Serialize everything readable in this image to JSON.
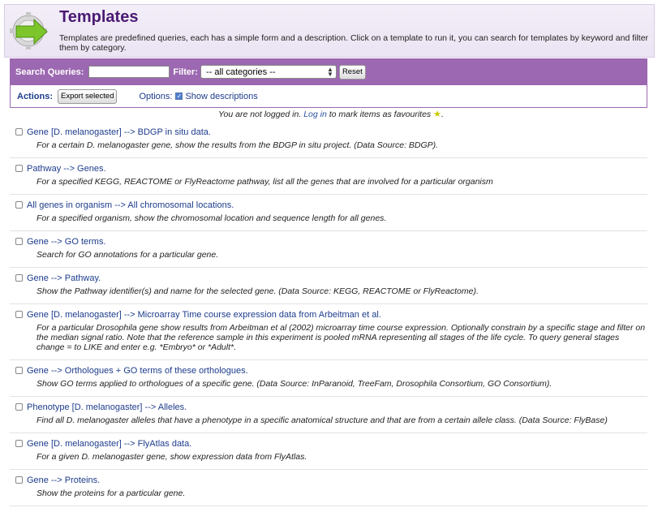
{
  "header": {
    "icon": "templates-gear-arrow-icon",
    "title": "Templates",
    "intro": "Templates are predefined queries, each has a simple form and a description. Click on a template to run it, you can search for templates by keyword and filter them by category."
  },
  "search": {
    "label": "Search Queries:",
    "value": "",
    "filter_label": "Filter:",
    "filter_value": "-- all categories --",
    "reset_label": "Reset"
  },
  "actions": {
    "label": "Actions:",
    "export_label": "Export selected",
    "options_label": "Options:",
    "show_descriptions_label": "Show descriptions",
    "show_descriptions_checked": true
  },
  "login_note": {
    "prefix": "You are not logged in.",
    "link": "Log in",
    "suffix": "to mark items as favourites",
    "star_icon": "star-icon"
  },
  "templates": [
    {
      "title": "Gene [D. melanogaster] --> BDGP in situ data.",
      "description": "For a certain D. melanogaster gene, show the results from the BDGP in situ project. (Data Source: BDGP)."
    },
    {
      "title": "Pathway --> Genes.",
      "description": "For a specified KEGG, REACTOME or FlyReactome pathway, list all the genes that are involved for a particular organism"
    },
    {
      "title": "All genes in organism --> All chromosomal locations.",
      "description": "For a specified organism, show the chromosomal location and sequence length for all genes."
    },
    {
      "title": "Gene --> GO terms.",
      "description": "Search for GO annotations for a particular gene."
    },
    {
      "title": "Gene --> Pathway.",
      "description": "Show the Pathway identifier(s) and name for the selected gene. (Data Source: KEGG, REACTOME or FlyReactome)."
    },
    {
      "title": "Gene [D. melanogaster] --> Microarray Time course expression data from Arbeitman et al.",
      "description": "For a particular Drosophila gene show results from Arbeitman et al (2002) microarray time course expression. Optionally constrain by a specific stage and filter on the median signal ratio. Note that the reference sample in this experiment is pooled mRNA representing all stages of the life cycle. To query general stages change = to LIKE and enter e.g. *Embryo* or *Adult*."
    },
    {
      "title": "Gene --> Orthologues + GO terms of these orthologues.",
      "description": "Show GO terms applied to orthologues of a specific gene. (Data Source: InParanoid, TreeFam, Drosophila Consortium, GO Consortium)."
    },
    {
      "title": "Phenotype [D. melanogaster] --> Alleles.",
      "description": "Find all D. melanogaster alleles that have a phenotype in a specific anatomical structure and that are from a certain allele class. (Data Source: FlyBase)"
    },
    {
      "title": "Gene [D. melanogaster] --> FlyAtlas data.",
      "description": "For a given D. melanogaster gene, show expression data from FlyAtlas."
    },
    {
      "title": "Gene --> Proteins.",
      "description": "Show the proteins for a particular gene."
    }
  ]
}
